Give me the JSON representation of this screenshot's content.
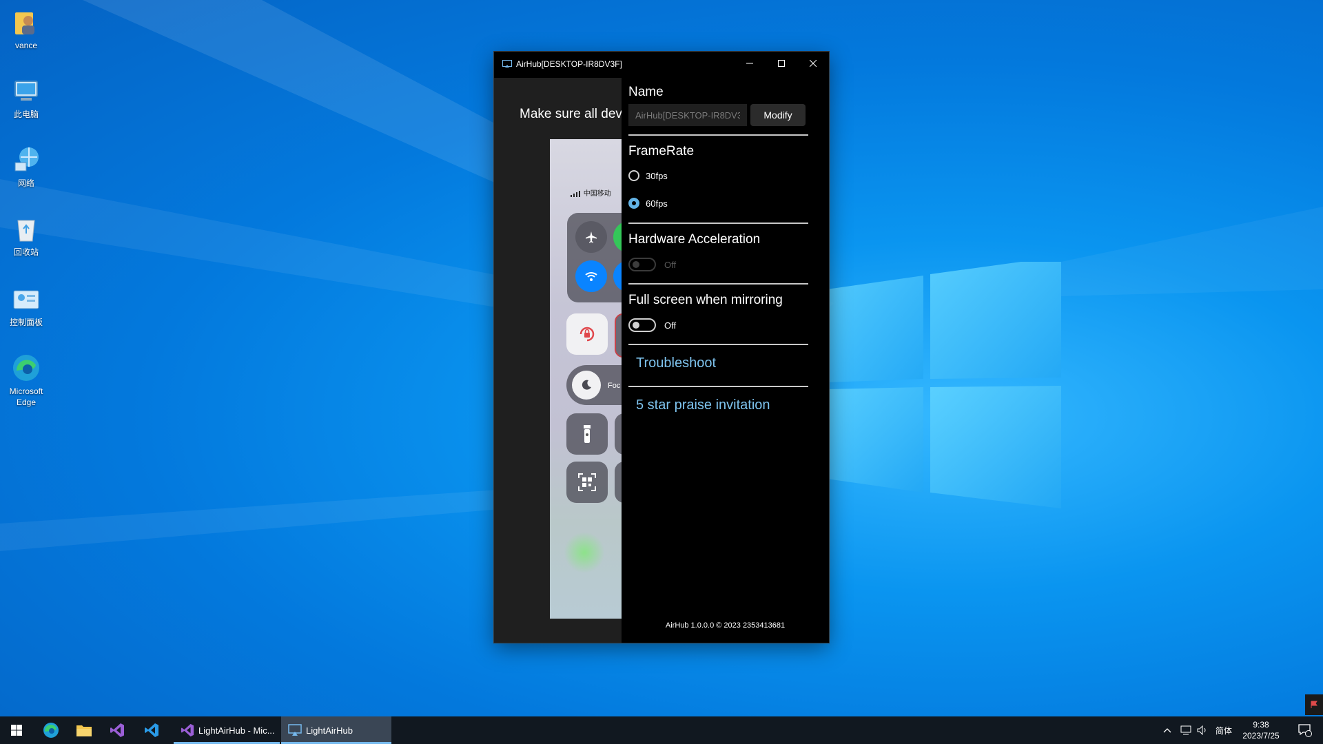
{
  "desktop": {
    "icons": [
      {
        "label": "vance",
        "icon": "user-folder-icon"
      },
      {
        "label": "此电脑",
        "icon": "this-pc-icon"
      },
      {
        "label": "网络",
        "icon": "network-icon"
      },
      {
        "label": "回收站",
        "icon": "recycle-bin-icon"
      },
      {
        "label": "控制面板",
        "icon": "control-panel-icon"
      },
      {
        "label": "Microsoft Edge",
        "icon": "edge-icon"
      }
    ]
  },
  "window": {
    "title": "AirHub[DESKTOP-IR8DV3F]",
    "left_pane": {
      "instruction": "Make sure all dev",
      "phone_carrier": "中国移动",
      "focus_label": "Foc"
    },
    "settings": {
      "name": {
        "title": "Name",
        "input_value": "AirHub[DESKTOP-IR8DV3F]",
        "modify_label": "Modify"
      },
      "framerate": {
        "title": "FrameRate",
        "options": [
          "30fps",
          "60fps"
        ],
        "selected": "60fps"
      },
      "hardware_acceleration": {
        "title": "Hardware Acceleration",
        "state": "Off",
        "enabled": false
      },
      "fullscreen": {
        "title": "Full screen when mirroring",
        "state": "Off"
      },
      "links": {
        "troubleshoot": "Troubleshoot",
        "praise": "5 star praise invitation"
      },
      "footer": "AirHub 1.0.0.0 © 2023 2353413681"
    }
  },
  "taskbar": {
    "apps": [
      {
        "label": "LightAirHub - Mic...",
        "icon": "visual-studio-icon"
      },
      {
        "label": "LightAirHub",
        "icon": "airhub-icon"
      }
    ],
    "ime": "简体",
    "time": "9:38",
    "date": "2023/7/25",
    "notification_count": "1"
  },
  "colors": {
    "accent": "#63b3e6",
    "link": "#7ec3ee",
    "desktop": "#0a8ef0"
  }
}
